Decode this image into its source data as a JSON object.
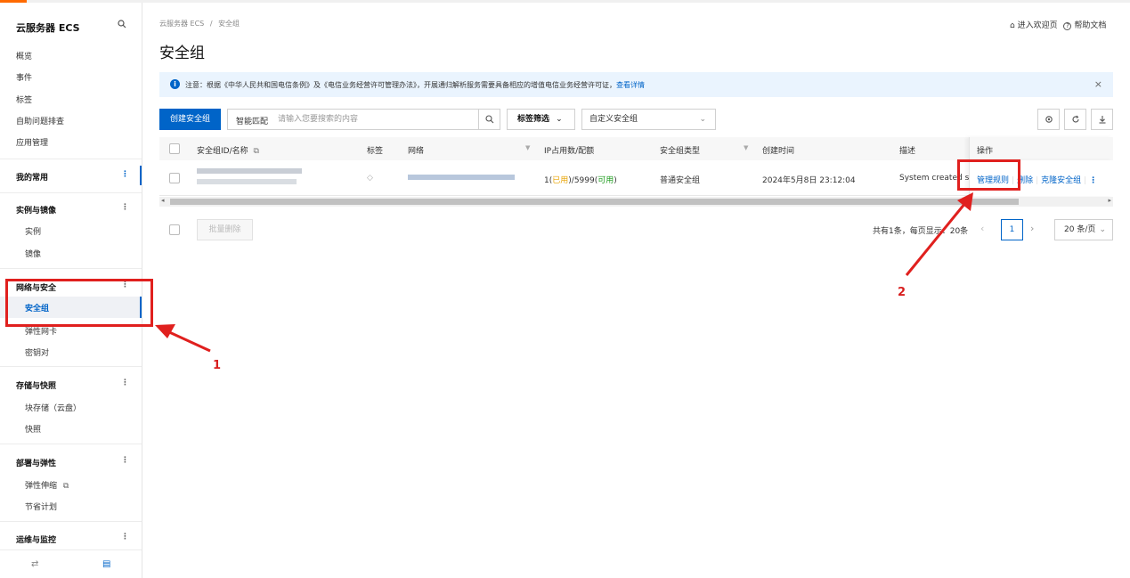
{
  "sidebar": {
    "title": "云服务器 ECS",
    "top_items": [
      "概览",
      "事件",
      "标签",
      "自助问题排查",
      "应用管理"
    ],
    "groups": {
      "favorites": "我的常用",
      "instances": {
        "title": "实例与镜像",
        "items": [
          "实例",
          "镜像"
        ]
      },
      "network": {
        "title": "网络与安全",
        "items": [
          "安全组",
          "弹性网卡",
          "密钥对"
        ]
      },
      "storage": {
        "title": "存储与快照",
        "items": [
          "块存储（云盘）",
          "快照"
        ]
      },
      "deploy": {
        "title": "部署与弹性",
        "items": [
          "弹性伸缩",
          "节省计划"
        ]
      },
      "ops": {
        "title": "运维与监控"
      }
    },
    "group_more": "⋮",
    "external_glyph": "⧉",
    "footer_left_glyph": "⇄",
    "footer_right_glyph": "▤"
  },
  "header": {
    "breadcrumb": [
      "云服务器 ECS",
      "安全组"
    ],
    "breadcrumb_sep": "/",
    "title": "安全组",
    "welcome_link": "进入欢迎页",
    "help_link": "帮助文档",
    "home_glyph": "⌂",
    "help_glyph": "?"
  },
  "notice": {
    "icon": "i",
    "text": "注意：根据《中华人民共和国电信条例》及《电信业务经营许可管理办法》，开展通归解析服务需要具备相应的增值电信业务经营许可证，",
    "link": "查看详情",
    "close": "×"
  },
  "toolbar": {
    "create_button": "创建安全组",
    "search_mode": "智能匹配",
    "search_placeholder": "请输入您要搜索的内容",
    "tag_filter": "标签筛选",
    "custom_select": "自定义安全组",
    "dropdown_glyph": "⌄"
  },
  "table": {
    "columns": [
      "安全组ID/名称",
      "标签",
      "网络",
      "IP占用数/配额",
      "安全组类型",
      "创建时间",
      "描述",
      "操作"
    ],
    "filter_glyph": "▼",
    "copy_glyph": "⧉",
    "tag_glyph": "◇",
    "rows": [
      {
        "ip_used": "1",
        "ip_used_label": "已用",
        "ip_quota": "5999",
        "ip_available_label": "可用",
        "type": "普通安全组",
        "created": "2024年5月8日 23:12:04",
        "description": "System created secu",
        "actions": [
          "管理规则",
          "删除",
          "克隆安全组"
        ],
        "more": "⋮"
      }
    ]
  },
  "footer": {
    "batch_delete": "批量删除",
    "total": "共有1条，每页显示：20条",
    "current_page": "1",
    "page_size": "20 条/页",
    "prev_glyph": "‹",
    "next_glyph": "›"
  },
  "annotations": {
    "callout_1": "1",
    "callout_2": "2",
    "color": "#e0201e"
  },
  "colors": {
    "primary": "#0064c8",
    "used": "#e8a200",
    "available": "#1a9a1a",
    "notice_bg": "#eaf4fe"
  }
}
